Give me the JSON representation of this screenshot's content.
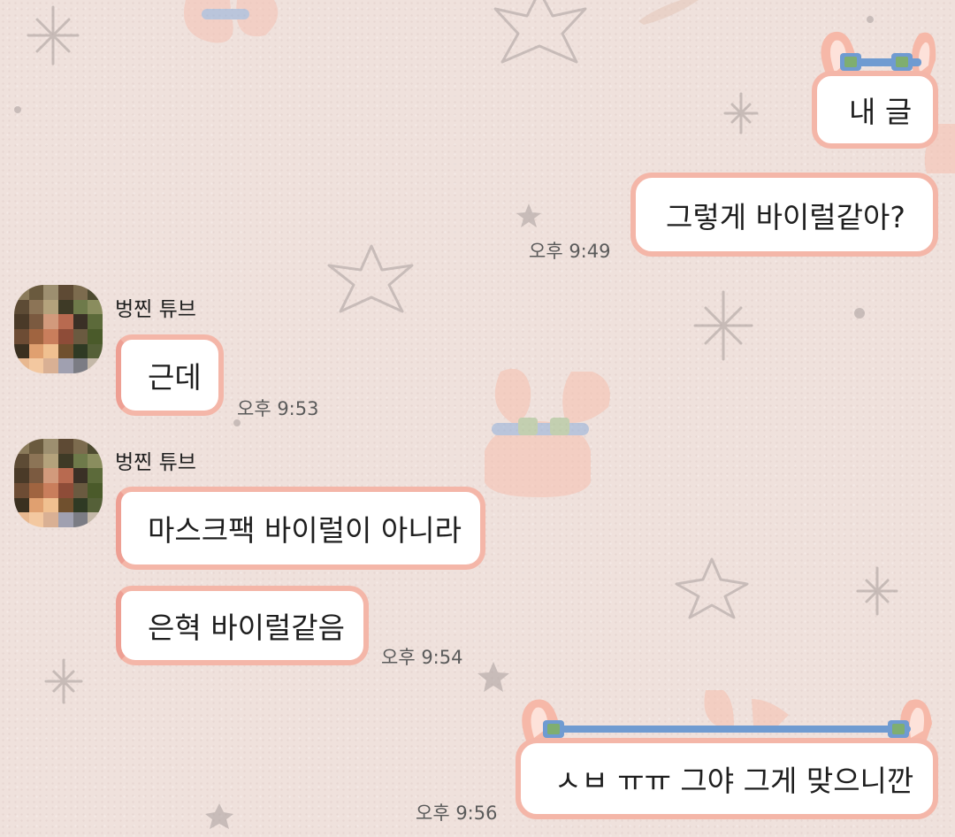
{
  "messages": [
    {
      "text": "내 글",
      "side": "right"
    },
    {
      "text": "그렇게 바이럴같아?",
      "side": "right",
      "time": "오후 9:49"
    },
    {
      "sender": "벙찐 튜브",
      "text": "근데",
      "side": "left",
      "time": "오후 9:53"
    },
    {
      "sender": "벙찐 튜브",
      "text": "마스크팩 바이럴이 아니라",
      "side": "left"
    },
    {
      "text": "은혁 바이럴같음",
      "side": "left",
      "time": "오후 9:54"
    },
    {
      "text": "ㅅㅂ ㅠㅠ 그야 그게 맞으니깐",
      "side": "right",
      "time": "오후 9:56"
    }
  ],
  "colors": {
    "background": "#efe1dc",
    "bubble_border": "#f4b6a8",
    "bubble_fill": "#ffffff",
    "goggle_strap": "#6f9bd1",
    "goggle_lens": "#7fae70"
  },
  "icons": {
    "avatar": "pixelated-avatar",
    "background": "star-and-bunny-pattern"
  }
}
